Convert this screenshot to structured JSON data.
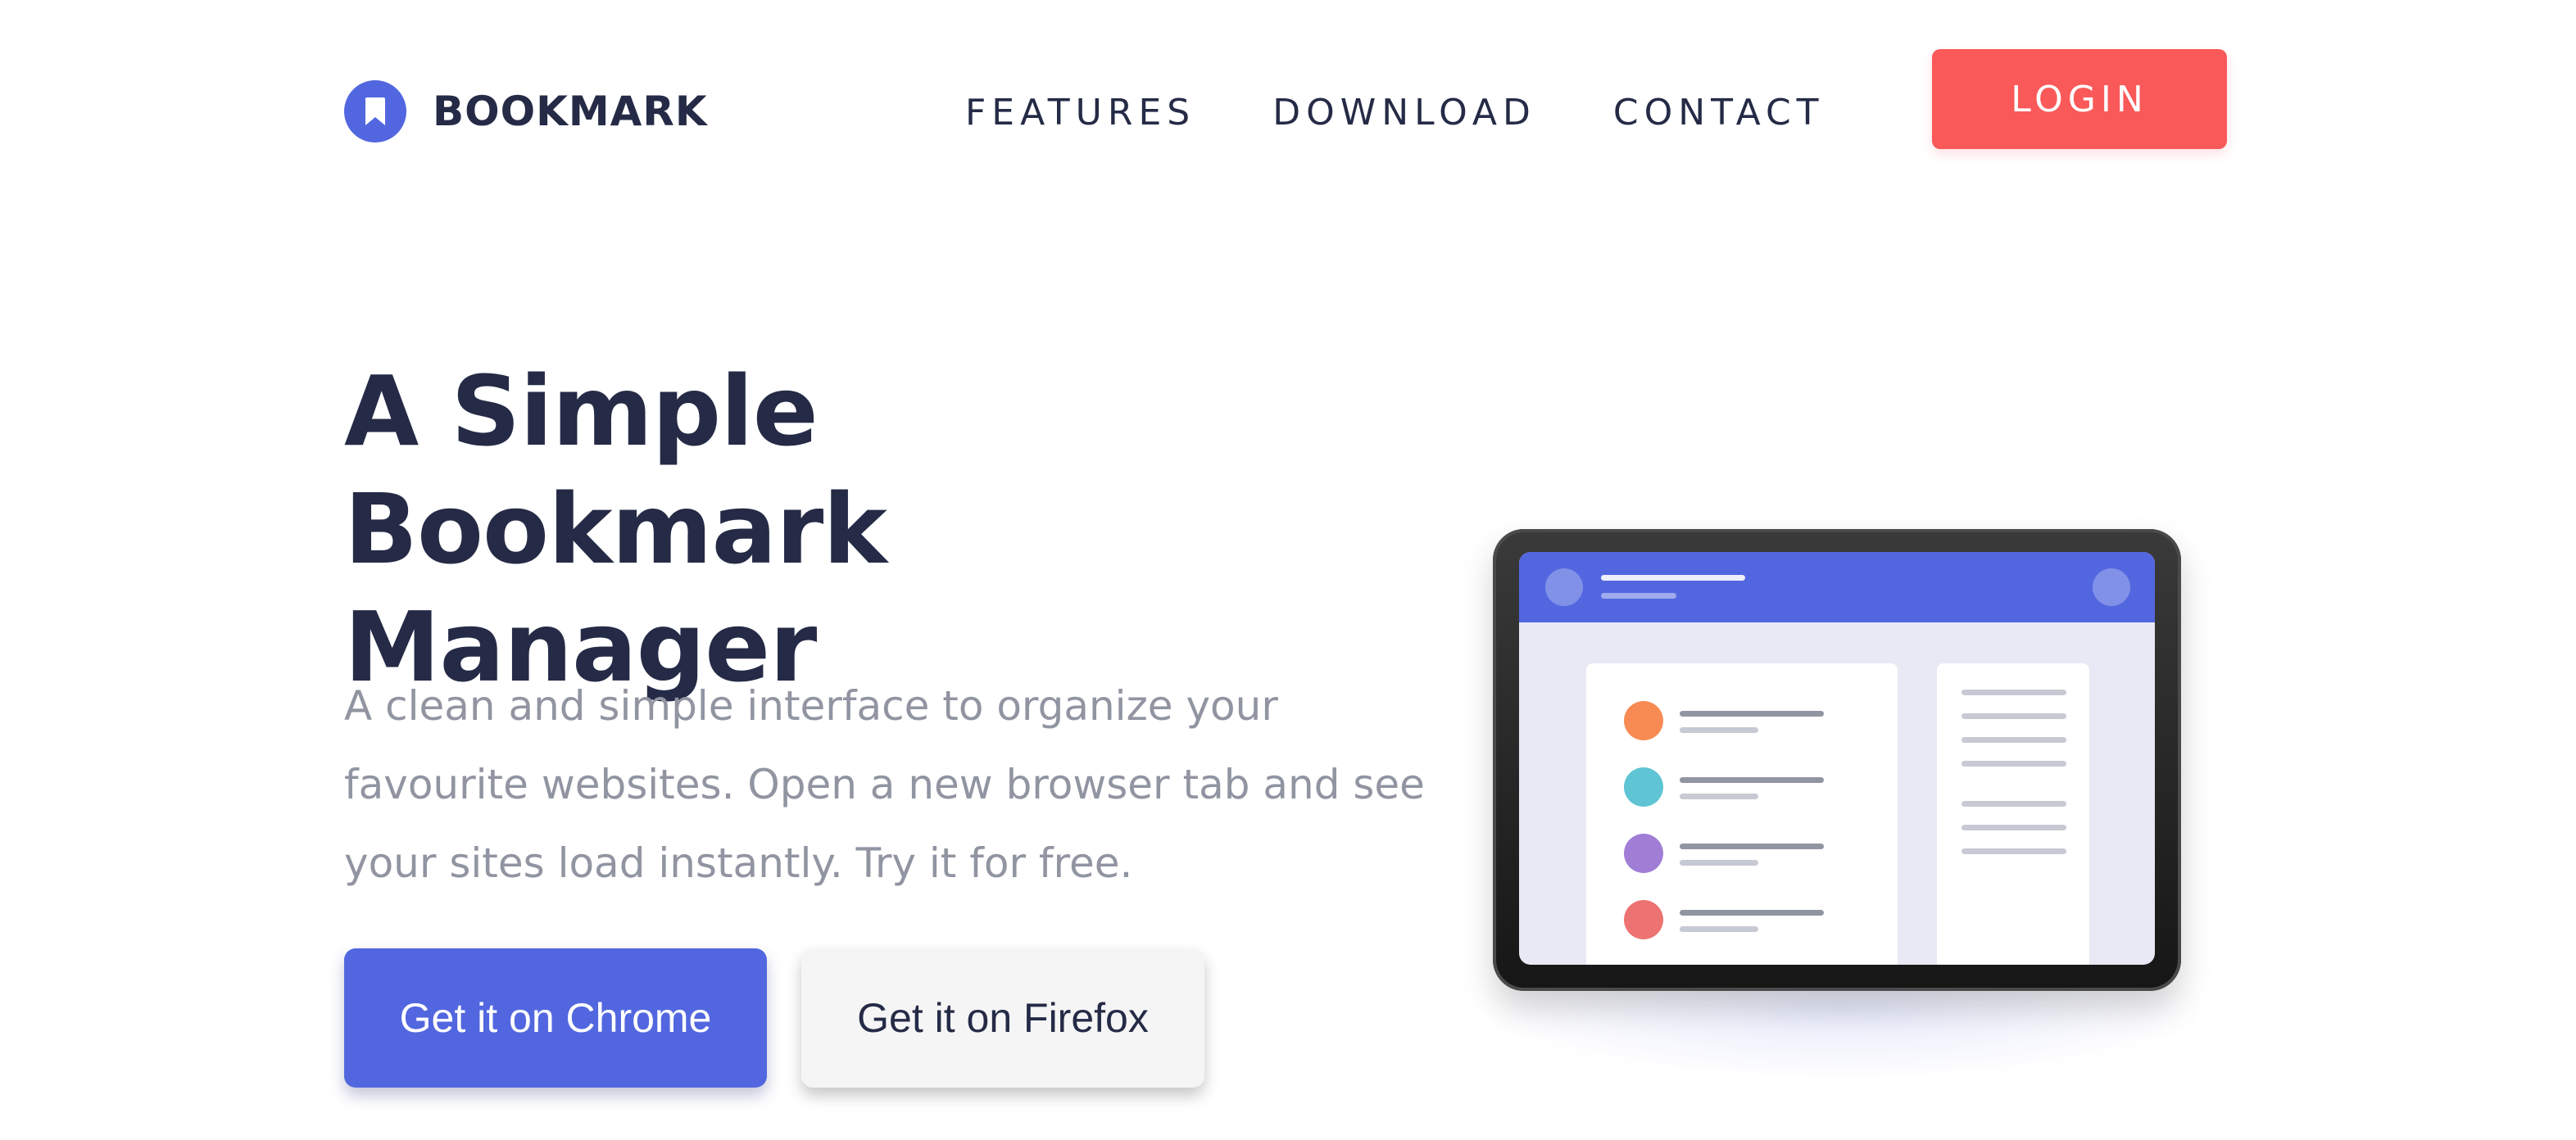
{
  "brand": {
    "name": "BOOKMARK",
    "color": "#5267df",
    "icon": "bookmark-icon"
  },
  "nav": {
    "items": [
      "FEATURES",
      "DOWNLOAD",
      "CONTACT"
    ],
    "login_label": "LOGIN",
    "login_color": "#fa5959"
  },
  "hero": {
    "title_line1": "A Simple Bookmark",
    "title_line2": "Manager",
    "subtitle": "A clean and simple interface to organize your favourite websites. Open a new browser tab and see your sites load instantly. Try it for free.",
    "chrome_button": "Get it on Chrome",
    "firefox_button": "Get it on Firefox"
  },
  "illustration": {
    "type": "tablet-mockup",
    "header_color": "#5267df",
    "bookmark_dot_colors": [
      "#f78b53",
      "#5fc4d3",
      "#a07ed6",
      "#ed7272"
    ]
  }
}
